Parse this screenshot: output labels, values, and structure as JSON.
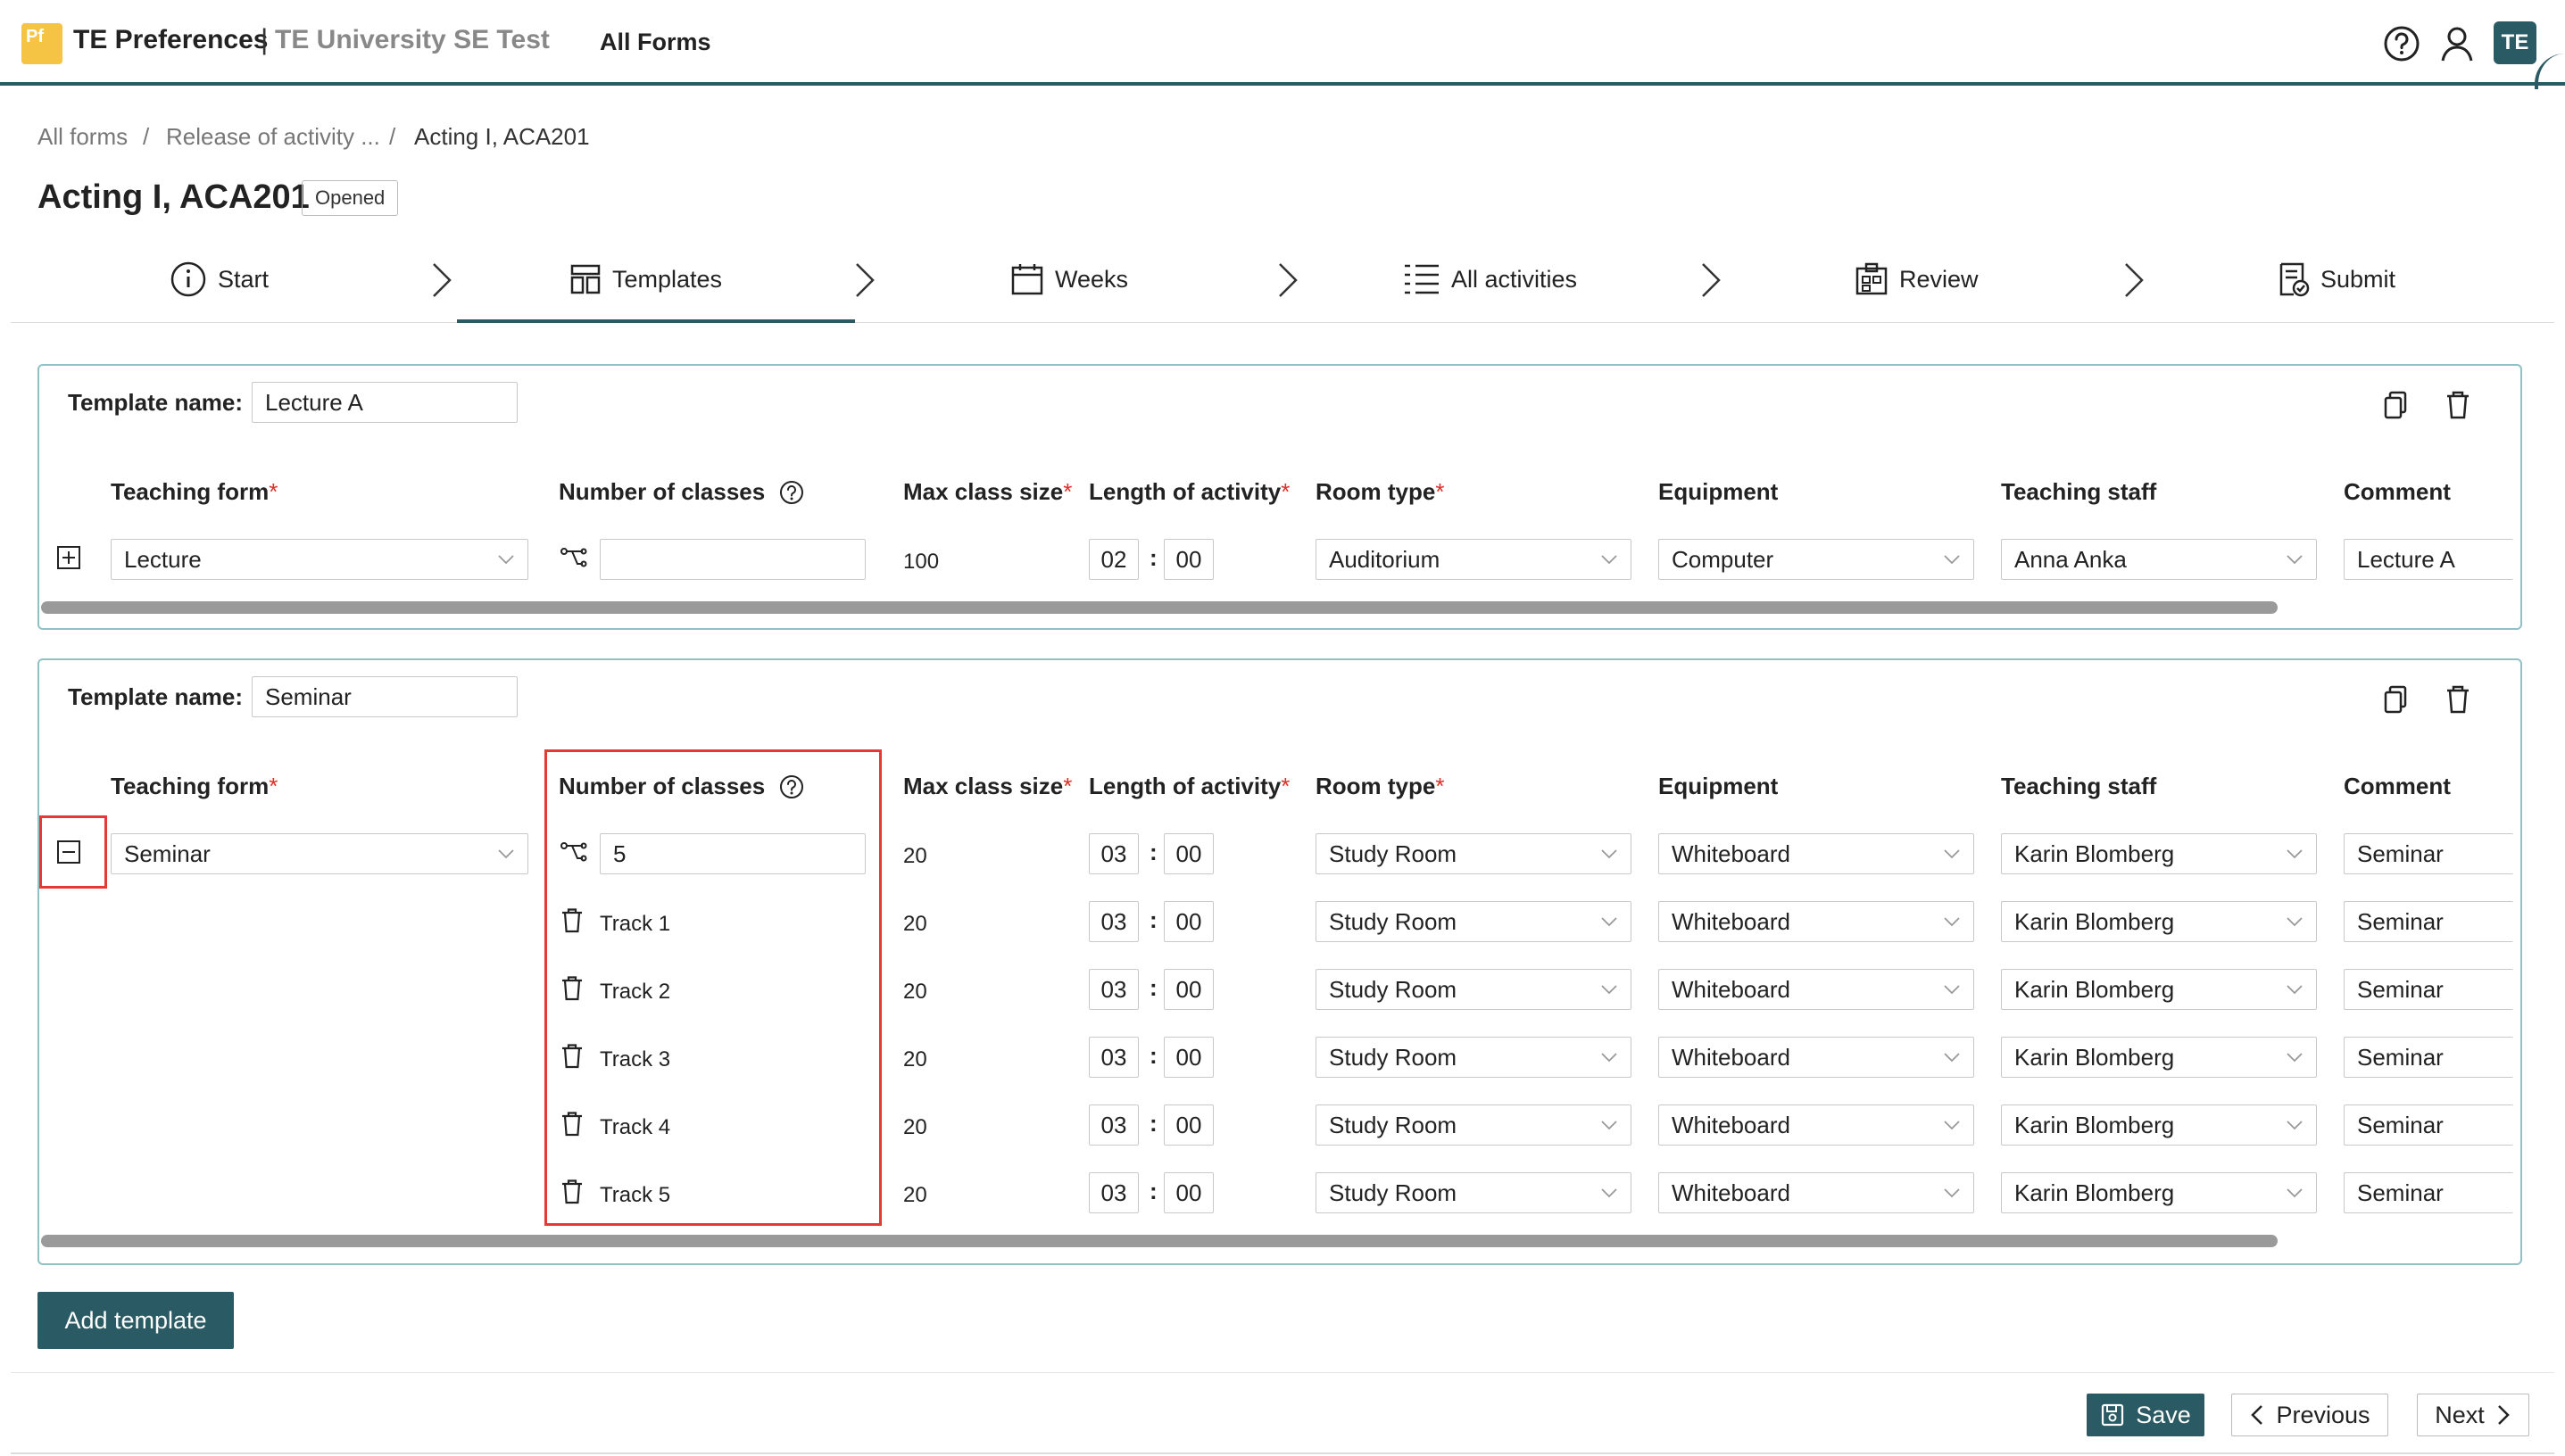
{
  "app": {
    "logo_text": "Pf",
    "title": "TE Preferences",
    "separator": "|",
    "subtitle": "TE University SE Test",
    "nav_all_forms": "All Forms",
    "avatar": "TE",
    "icons": [
      "help-circle-icon",
      "user-icon"
    ]
  },
  "breadcrumb": {
    "items": [
      "All forms",
      "Release of activity ...",
      "Acting I, ACA201"
    ],
    "sep": "/"
  },
  "page": {
    "title": "Acting I, ACA201",
    "status": "Opened"
  },
  "steps": [
    {
      "label": "Start",
      "icon": "info-icon"
    },
    {
      "label": "Templates",
      "icon": "templates-icon",
      "active": true
    },
    {
      "label": "Weeks",
      "icon": "calendar-icon"
    },
    {
      "label": "All activities",
      "icon": "list-icon"
    },
    {
      "label": "Review",
      "icon": "review-icon"
    },
    {
      "label": "Submit",
      "icon": "submit-icon"
    }
  ],
  "columns": {
    "teaching_form": "Teaching form",
    "number_of_classes": "Number of classes",
    "max_class_size": "Max class size",
    "length_of_activity": "Length of activity",
    "room_type": "Room type",
    "equipment": "Equipment",
    "teaching_staff": "Teaching staff",
    "comment": "Comment",
    "required_mark": "*",
    "time_separator": ":"
  },
  "template_name_label": "Template name:",
  "templates": [
    {
      "name": "Lecture A",
      "main": {
        "teaching_form": "Lecture",
        "number_of_classes": "",
        "max_class_size": "100",
        "hours": "02",
        "minutes": "00",
        "room_type": "Auditorium",
        "equipment": "Computer",
        "teaching_staff": "Anna Anka",
        "comment": "Lecture A"
      },
      "tracks": []
    },
    {
      "name": "Seminar",
      "main": {
        "teaching_form": "Seminar",
        "number_of_classes": "5",
        "max_class_size": "20",
        "hours": "03",
        "minutes": "00",
        "room_type": "Study Room",
        "equipment": "Whiteboard",
        "teaching_staff": "Karin Blomberg",
        "comment": "Seminar"
      },
      "tracks": [
        {
          "label": "Track 1",
          "max_class_size": "20",
          "hours": "03",
          "minutes": "00",
          "room_type": "Study Room",
          "equipment": "Whiteboard",
          "teaching_staff": "Karin Blomberg",
          "comment": "Seminar"
        },
        {
          "label": "Track 2",
          "max_class_size": "20",
          "hours": "03",
          "minutes": "00",
          "room_type": "Study Room",
          "equipment": "Whiteboard",
          "teaching_staff": "Karin Blomberg",
          "comment": "Seminar"
        },
        {
          "label": "Track 3",
          "max_class_size": "20",
          "hours": "03",
          "minutes": "00",
          "room_type": "Study Room",
          "equipment": "Whiteboard",
          "teaching_staff": "Karin Blomberg",
          "comment": "Seminar"
        },
        {
          "label": "Track 4",
          "max_class_size": "20",
          "hours": "03",
          "minutes": "00",
          "room_type": "Study Room",
          "equipment": "Whiteboard",
          "teaching_staff": "Karin Blomberg",
          "comment": "Seminar"
        },
        {
          "label": "Track 5",
          "max_class_size": "20",
          "hours": "03",
          "minutes": "00",
          "room_type": "Study Room",
          "equipment": "Whiteboard",
          "teaching_staff": "Karin Blomberg",
          "comment": "Seminar"
        }
      ]
    }
  ],
  "actions": {
    "add_template": "Add template",
    "save": "Save",
    "previous": "Previous",
    "next": "Next"
  },
  "colors": {
    "brand": "#2a5a63",
    "card_border": "#8fc1c5",
    "highlight": "#e53935",
    "logo": "#f6c444"
  }
}
